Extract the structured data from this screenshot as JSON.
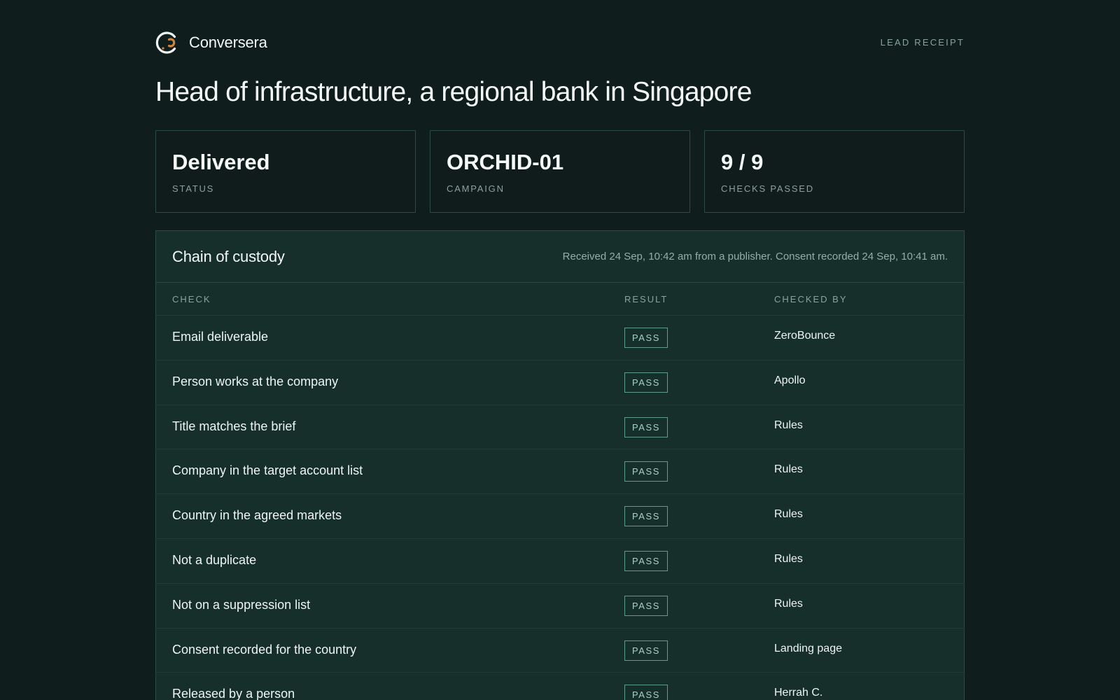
{
  "brand": {
    "name": "Conversera",
    "logo_icon": "circular-c-logo-icon",
    "accent_color": "#d4833a"
  },
  "header": {
    "receipt_label": "LEAD RECEIPT",
    "title": "Head of infrastructure, a regional bank in Singapore"
  },
  "stats": [
    {
      "value": "Delivered",
      "label": "STATUS"
    },
    {
      "value": "ORCHID-01",
      "label": "CAMPAIGN"
    },
    {
      "value": "9 / 9",
      "label": "CHECKS PASSED"
    }
  ],
  "custody": {
    "title": "Chain of custody",
    "note": "Received 24 Sep, 10:42 am from a publisher. Consent recorded 24 Sep, 10:41 am.",
    "columns": {
      "check": "CHECK",
      "result": "RESULT",
      "checked_by": "CHECKED BY"
    },
    "rows": [
      {
        "check": "Email deliverable",
        "result": "PASS",
        "by": "ZeroBounce"
      },
      {
        "check": "Person works at the company",
        "result": "PASS",
        "by": "Apollo"
      },
      {
        "check": "Title matches the brief",
        "result": "PASS",
        "by": "Rules"
      },
      {
        "check": "Company in the target account list",
        "result": "PASS",
        "by": "Rules"
      },
      {
        "check": "Country in the agreed markets",
        "result": "PASS",
        "by": "Rules"
      },
      {
        "check": "Not a duplicate",
        "result": "PASS",
        "by": "Rules"
      },
      {
        "check": "Not on a suppression list",
        "result": "PASS",
        "by": "Rules"
      },
      {
        "check": "Consent recorded for the country",
        "result": "PASS",
        "by": "Landing page"
      },
      {
        "check": "Released by a person",
        "result": "PASS",
        "by": "Herrah C."
      }
    ]
  },
  "colors": {
    "background": "#0f1e1c",
    "panel": "#172f2a",
    "border": "#2b4a43",
    "pass_border": "#5e9c8e",
    "pass_text": "#a4d2c6"
  }
}
